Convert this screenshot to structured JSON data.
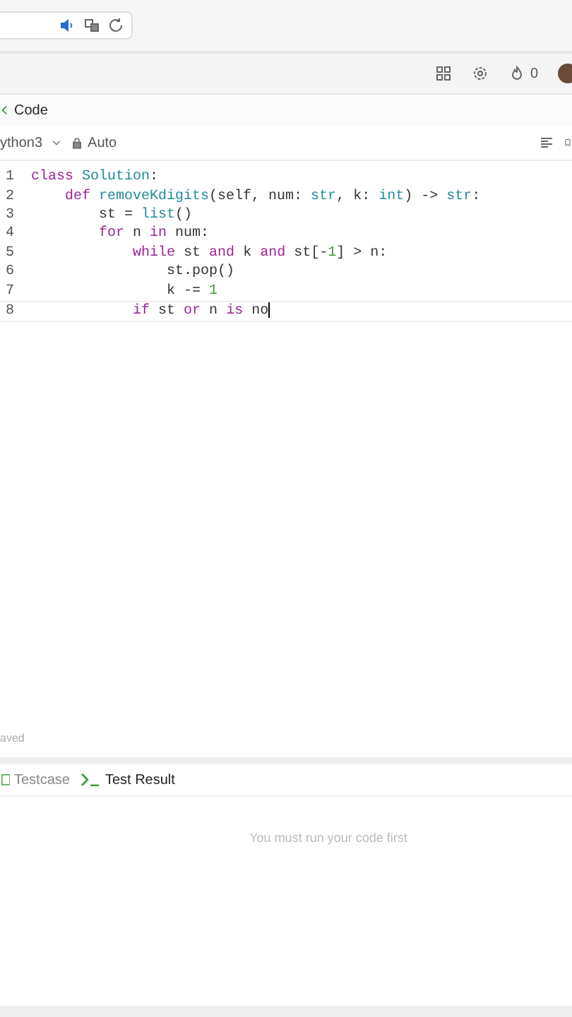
{
  "header": {
    "streak_count": "0"
  },
  "code_tab": {
    "label": "Code"
  },
  "editor_toolbar": {
    "language": "ython3",
    "mode": "Auto"
  },
  "code_lines": [
    {
      "number": "1",
      "current": false,
      "tokens": [
        {
          "kind": "kw",
          "text": "class "
        },
        {
          "kind": "type",
          "text": "Solution"
        },
        {
          "kind": "plain",
          "text": ":"
        }
      ]
    },
    {
      "number": "2",
      "current": false,
      "tokens": [
        {
          "kind": "kw",
          "text": "    def "
        },
        {
          "kind": "fn",
          "text": "removeKdigits"
        },
        {
          "kind": "plain",
          "text": "(self, num: "
        },
        {
          "kind": "type",
          "text": "str"
        },
        {
          "kind": "plain",
          "text": ", k: "
        },
        {
          "kind": "type",
          "text": "int"
        },
        {
          "kind": "plain",
          "text": ") -> "
        },
        {
          "kind": "type",
          "text": "str"
        },
        {
          "kind": "plain",
          "text": ":"
        }
      ]
    },
    {
      "number": "3",
      "current": false,
      "tokens": [
        {
          "kind": "plain",
          "text": "        st = "
        },
        {
          "kind": "fn",
          "text": "list"
        },
        {
          "kind": "plain",
          "text": "()"
        }
      ]
    },
    {
      "number": "4",
      "current": false,
      "tokens": [
        {
          "kind": "kw",
          "text": "        for "
        },
        {
          "kind": "plain",
          "text": "n "
        },
        {
          "kind": "kw",
          "text": "in "
        },
        {
          "kind": "plain",
          "text": "num:"
        }
      ]
    },
    {
      "number": "5",
      "current": false,
      "tokens": [
        {
          "kind": "kw",
          "text": "            while "
        },
        {
          "kind": "plain",
          "text": "st "
        },
        {
          "kind": "kw",
          "text": "and "
        },
        {
          "kind": "plain",
          "text": "k "
        },
        {
          "kind": "kw",
          "text": "and "
        },
        {
          "kind": "plain",
          "text": "st[-"
        },
        {
          "kind": "num",
          "text": "1"
        },
        {
          "kind": "plain",
          "text": "] > n:"
        }
      ]
    },
    {
      "number": "6",
      "current": false,
      "tokens": [
        {
          "kind": "plain",
          "text": "                st.pop()"
        }
      ]
    },
    {
      "number": "7",
      "current": false,
      "tokens": [
        {
          "kind": "plain",
          "text": "                k -= "
        },
        {
          "kind": "num",
          "text": "1"
        }
      ]
    },
    {
      "number": "8",
      "current": true,
      "tokens": [
        {
          "kind": "kw",
          "text": "            if "
        },
        {
          "kind": "plain",
          "text": "st "
        },
        {
          "kind": "kw",
          "text": "or "
        },
        {
          "kind": "plain",
          "text": "n "
        },
        {
          "kind": "kw",
          "text": "is "
        },
        {
          "kind": "plain",
          "text": "no"
        }
      ]
    }
  ],
  "save_status": "aved",
  "bottom_tabs": [
    {
      "label": "Testcase",
      "selected": false
    },
    {
      "label": "Test Result",
      "selected": true
    }
  ],
  "result_message": "You must run your code first"
}
